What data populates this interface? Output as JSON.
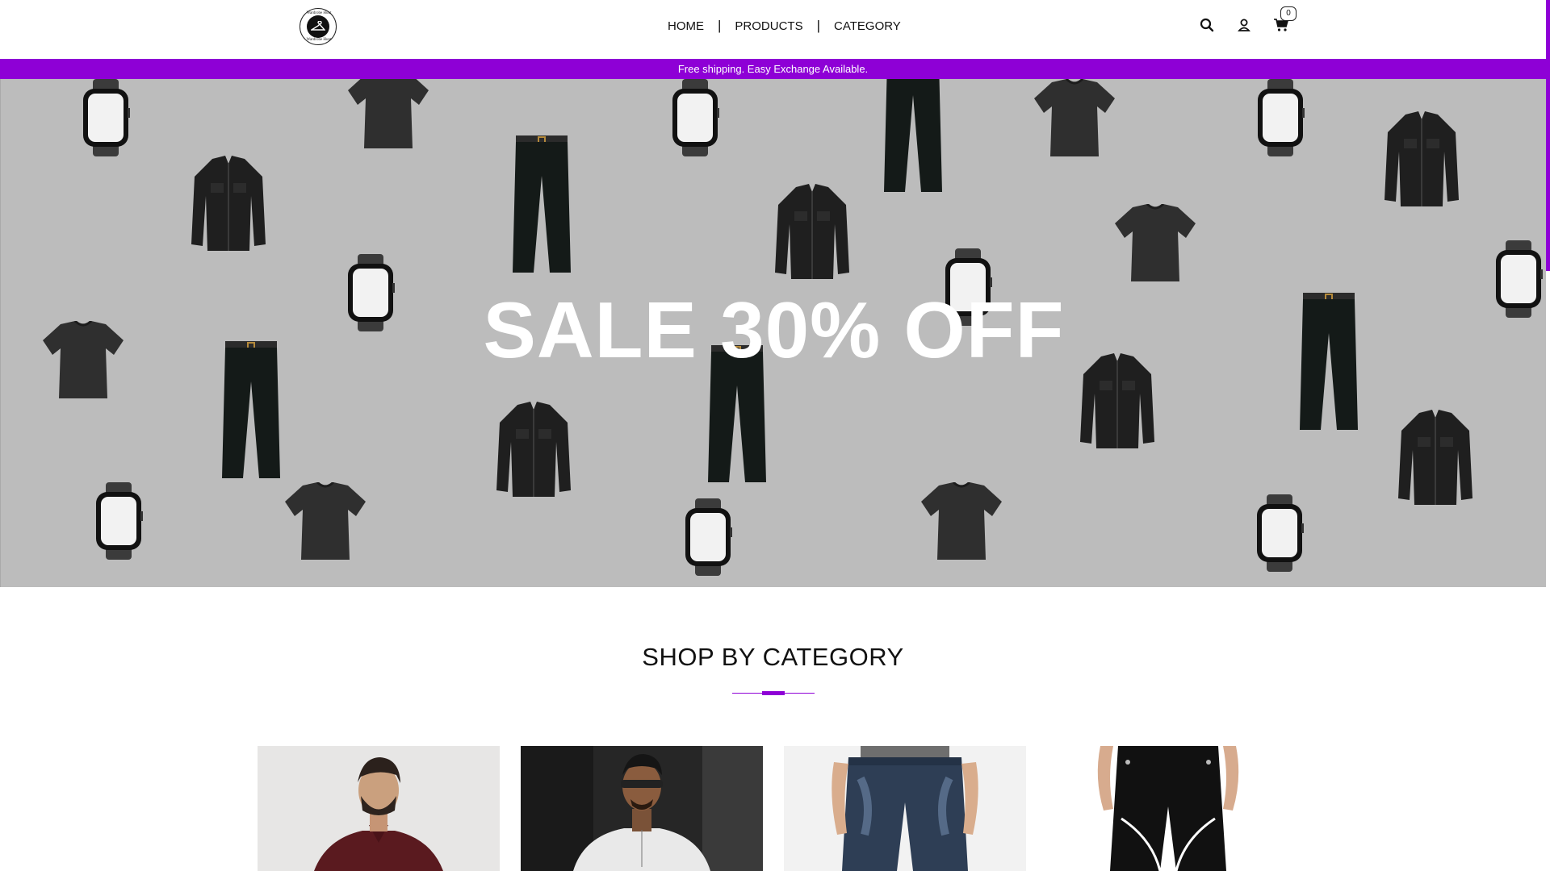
{
  "header": {
    "logo_alt": "Wardrobe Hunt",
    "nav": {
      "home": "HOME",
      "products": "PRODUCTS",
      "category": "CATEGORY",
      "separator": "|"
    },
    "cart_count": "0",
    "icons": [
      "search-icon",
      "user-icon",
      "cart-icon"
    ]
  },
  "promo": {
    "text": "Free shipping. Easy Exchange Available.",
    "background": "#8e00d6"
  },
  "hero": {
    "title": "SALE 30% OFF",
    "background": "#bcbcbc"
  },
  "section": {
    "title": "SHOP BY CATEGORY",
    "accent": "#8e00d6"
  },
  "categories": [
    {
      "name": "shirt-category"
    },
    {
      "name": "tshirt-category"
    },
    {
      "name": "jeans-category"
    },
    {
      "name": "trousers-category"
    }
  ]
}
